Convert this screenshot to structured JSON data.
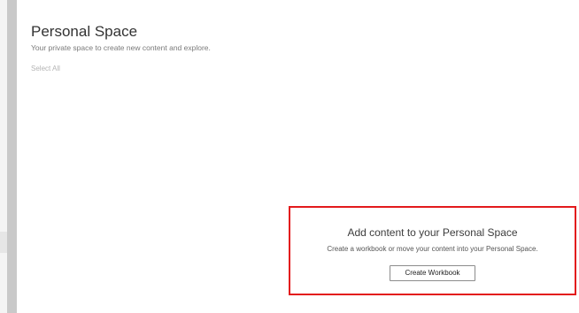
{
  "header": {
    "title": "Personal Space",
    "subtitle": "Your private space to create new content and explore."
  },
  "toolbar": {
    "select_all_label": "Select All"
  },
  "empty_state": {
    "title": "Add content to your Personal Space",
    "description": "Create a workbook or move your content into your Personal Space.",
    "create_button_label": "Create Workbook",
    "highlight_color": "#e31a1c"
  }
}
